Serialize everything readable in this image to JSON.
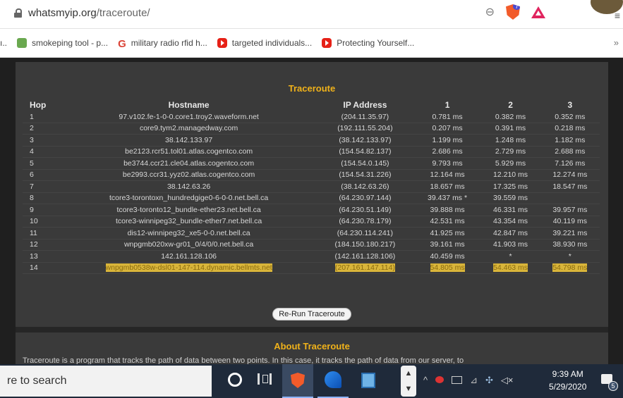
{
  "browser": {
    "url_host": "whatsmyip.org",
    "url_path": "/traceroute/",
    "shield_badge": "7",
    "menu_glyph": "≡"
  },
  "bookmarks": [
    {
      "label": "smokeping tool - p...",
      "icon": "smokeping-favicon"
    },
    {
      "label": "military radio rfid h...",
      "icon": "google-favicon"
    },
    {
      "label": "targeted individuals...",
      "icon": "youtube-favicon"
    },
    {
      "label": "Protecting Yourself...",
      "icon": "youtube-favicon"
    }
  ],
  "bookmarks_more": "»",
  "bookmarks_left_edge": "ı..",
  "traceroute": {
    "title": "Traceroute",
    "headers": [
      "Hop",
      "Hostname",
      "IP Address",
      "1",
      "2",
      "3"
    ],
    "rows": [
      [
        "1",
        "97.v102.fe-1-0-0.core1.troy2.waveform.net",
        "(204.11.35.97)",
        "0.781 ms",
        "0.382 ms",
        "0.352 ms"
      ],
      [
        "2",
        "core9.tym2.managedway.com",
        "(192.111.55.204)",
        "0.207 ms",
        "0.391 ms",
        "0.218 ms"
      ],
      [
        "3",
        "38.142.133.97",
        "(38.142.133.97)",
        "1.199 ms",
        "1.248 ms",
        "1.182 ms"
      ],
      [
        "4",
        "be2123.rcr51.tol01.atlas.cogentco.com",
        "(154.54.82.137)",
        "2.686 ms",
        "2.729 ms",
        "2.688 ms"
      ],
      [
        "5",
        "be3744.ccr21.cle04.atlas.cogentco.com",
        "(154.54.0.145)",
        "9.793 ms",
        "5.929 ms",
        "7.126 ms"
      ],
      [
        "6",
        "be2993.ccr31.yyz02.atlas.cogentco.com",
        "(154.54.31.226)",
        "12.164 ms",
        "12.210 ms",
        "12.274 ms"
      ],
      [
        "7",
        "38.142.63.26",
        "(38.142.63.26)",
        "18.657 ms",
        "17.325 ms",
        "18.547 ms"
      ],
      [
        "8",
        "tcore3-torontoxn_hundredgige0-6-0-0.net.bell.ca",
        "(64.230.97.144)",
        "39.437 ms *",
        "39.559 ms",
        ""
      ],
      [
        "9",
        "tcore3-toronto12_bundle-ether23.net.bell.ca",
        "(64.230.51.149)",
        "39.888 ms",
        "46.331 ms",
        "39.957 ms"
      ],
      [
        "10",
        "tcore3-winnipeg32_bundle-ether7.net.bell.ca",
        "(64.230.78.179)",
        "42.531 ms",
        "43.354 ms",
        "40.119 ms"
      ],
      [
        "11",
        "dis12-winnipeg32_xe5-0-0.net.bell.ca",
        "(64.230.114.241)",
        "41.925 ms",
        "42.847 ms",
        "39.221 ms"
      ],
      [
        "12",
        "wnpgmb020xw-gr01_0/4/0/0.net.bell.ca",
        "(184.150.180.217)",
        "39.161 ms",
        "41.903 ms",
        "38.930 ms"
      ],
      [
        "13",
        "142.161.128.106",
        "(142.161.128.106)",
        "40.459 ms",
        "*",
        "*"
      ],
      [
        "14",
        "wnpgmb0538w-dsl01-147-114.dynamic.bellmts.net",
        "(207.161.147.114)",
        "54.805 ms",
        "54.463 ms",
        "54.798 ms"
      ]
    ],
    "highlighted_row": 14,
    "rerun_label": "Re-Run Traceroute"
  },
  "about": {
    "title": "About Traceroute",
    "text": "Traceroute is a program that tracks the path of data between two points. In this case, it tracks the path of data from our server, to"
  },
  "taskbar": {
    "search_text": "re to search",
    "tray_up": "^",
    "time": "9:39 AM",
    "date": "5/29/2020",
    "notification_count": "5"
  },
  "colors": {
    "accent": "#f0b21a",
    "highlight": "#d9b53a",
    "panel": "#3a3a3a"
  }
}
